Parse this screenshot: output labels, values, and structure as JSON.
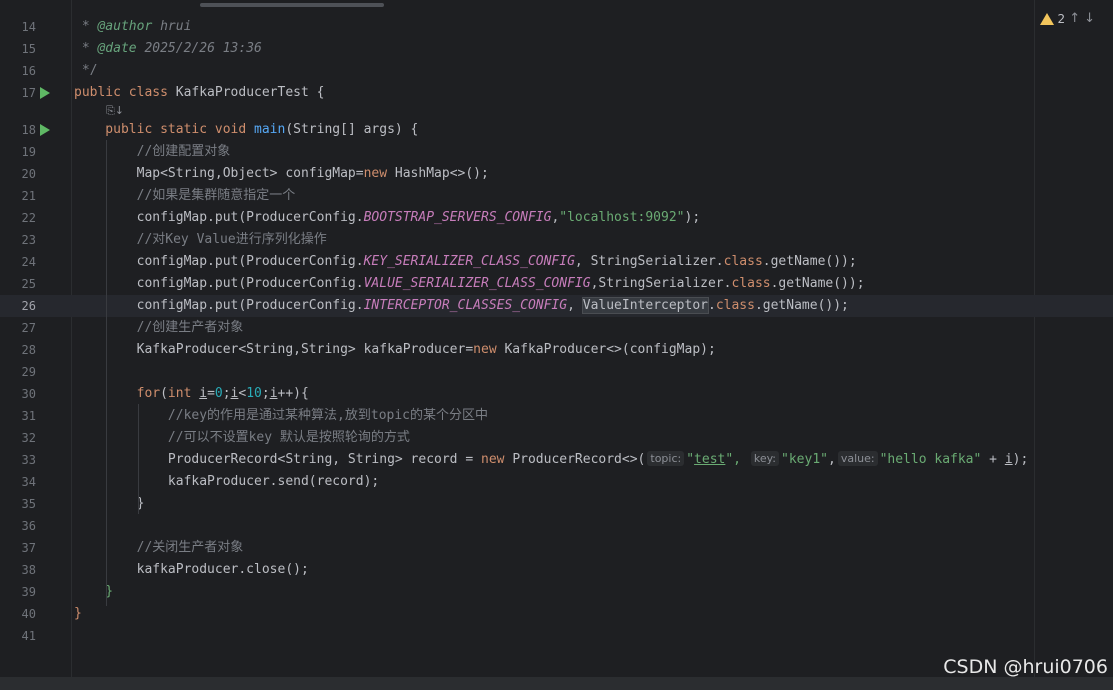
{
  "editor": {
    "warnings": {
      "count": "2"
    },
    "inline_hint": "⎘↓",
    "lines": [
      {
        "n": "14",
        "tokens": [
          {
            "t": " * ",
            "c": "cmt"
          },
          {
            "t": "@author",
            "c": "doctag"
          },
          {
            "t": " hrui",
            "c": "docval"
          }
        ]
      },
      {
        "n": "15",
        "tokens": [
          {
            "t": " * ",
            "c": "cmt"
          },
          {
            "t": "@date",
            "c": "doctag"
          },
          {
            "t": " 2025/2/26 13:36",
            "c": "docval"
          }
        ]
      },
      {
        "n": "16",
        "tokens": [
          {
            "t": " */",
            "c": "cmt"
          }
        ]
      },
      {
        "n": "17",
        "run": true,
        "tokens": [
          {
            "t": "public class ",
            "c": "kw"
          },
          {
            "t": "KafkaProducerTest ",
            "c": "cls"
          },
          {
            "t": "{",
            "c": "dim"
          }
        ]
      },
      {
        "n": "18",
        "run": true,
        "tokens": [
          {
            "t": "    public static void ",
            "c": "kw"
          },
          {
            "t": "main",
            "c": "fn"
          },
          {
            "t": "(String[] args) {",
            "c": "dim"
          }
        ]
      },
      {
        "n": "19",
        "tokens": [
          {
            "t": "        //创建配置对象",
            "c": "cmt"
          }
        ]
      },
      {
        "n": "20",
        "tokens": [
          {
            "t": "        Map<String,Object> configMap=",
            "c": "dim"
          },
          {
            "t": "new ",
            "c": "kw"
          },
          {
            "t": "HashMap<>();",
            "c": "dim"
          }
        ]
      },
      {
        "n": "21",
        "tokens": [
          {
            "t": "        //如果是集群随意指定一个",
            "c": "cmt"
          }
        ]
      },
      {
        "n": "22",
        "tokens": [
          {
            "t": "        configMap.put(ProducerConfig.",
            "c": "dim"
          },
          {
            "t": "BOOTSTRAP_SERVERS_CONFIG",
            "c": "konst"
          },
          {
            "t": ",",
            "c": "dim"
          },
          {
            "t": "\"localhost:9092\"",
            "c": "str"
          },
          {
            "t": ");",
            "c": "dim"
          }
        ]
      },
      {
        "n": "23",
        "tokens": [
          {
            "t": "        //对Key Value进行序列化操作",
            "c": "cmt"
          }
        ]
      },
      {
        "n": "24",
        "tokens": [
          {
            "t": "        configMap.put(ProducerConfig.",
            "c": "dim"
          },
          {
            "t": "KEY_SERIALIZER_CLASS_CONFIG",
            "c": "konst"
          },
          {
            "t": ", StringSerializer.",
            "c": "dim"
          },
          {
            "t": "class",
            "c": "kw"
          },
          {
            "t": ".getName());",
            "c": "dim"
          }
        ]
      },
      {
        "n": "25",
        "tokens": [
          {
            "t": "        configMap.put(ProducerConfig.",
            "c": "dim"
          },
          {
            "t": "VALUE_SERIALIZER_CLASS_CONFIG",
            "c": "konst"
          },
          {
            "t": ",StringSerializer.",
            "c": "dim"
          },
          {
            "t": "class",
            "c": "kw"
          },
          {
            "t": ".getName());",
            "c": "dim"
          }
        ]
      },
      {
        "n": "26",
        "current": true,
        "tokens": [
          {
            "t": "        configMap.put(ProducerConfig.",
            "c": "dim"
          },
          {
            "t": "INTERCEPTOR_CLASSES_CONFIG",
            "c": "konst"
          },
          {
            "t": ", ",
            "c": "dim"
          },
          {
            "t": "ValueInterceptor",
            "c": "dim highlight-word"
          },
          {
            "t": ".",
            "c": "dim"
          },
          {
            "t": "class",
            "c": "kw"
          },
          {
            "t": ".getName());",
            "c": "dim"
          }
        ]
      },
      {
        "n": "27",
        "tokens": [
          {
            "t": "        //创建生产者对象",
            "c": "cmt"
          }
        ]
      },
      {
        "n": "28",
        "tokens": [
          {
            "t": "        KafkaProducer<String,String> kafkaProducer=",
            "c": "dim"
          },
          {
            "t": "new ",
            "c": "kw"
          },
          {
            "t": "KafkaProducer<>(configMap);",
            "c": "dim"
          }
        ]
      },
      {
        "n": "29",
        "tokens": []
      },
      {
        "n": "30",
        "tokens": [
          {
            "t": "        for",
            "c": "kw"
          },
          {
            "t": "(",
            "c": "dim"
          },
          {
            "t": "int ",
            "c": "kw"
          },
          {
            "t": "i",
            "c": "dim underline"
          },
          {
            "t": "=",
            "c": "dim"
          },
          {
            "t": "0",
            "c": "num"
          },
          {
            "t": ";",
            "c": "dim"
          },
          {
            "t": "i",
            "c": "dim underline"
          },
          {
            "t": "<",
            "c": "dim"
          },
          {
            "t": "10",
            "c": "num"
          },
          {
            "t": ";",
            "c": "dim"
          },
          {
            "t": "i",
            "c": "dim underline"
          },
          {
            "t": "++){",
            "c": "dim"
          }
        ]
      },
      {
        "n": "31",
        "tokens": [
          {
            "t": "            //key的作用是通过某种算法,放到topic的某个分区中",
            "c": "cmt"
          }
        ]
      },
      {
        "n": "32",
        "tokens": [
          {
            "t": "            //可以不设置key 默认是按照轮询的方式",
            "c": "cmt"
          }
        ]
      },
      {
        "n": "33",
        "tokens": [
          {
            "t": "            ProducerRecord<String, String> record = ",
            "c": "dim"
          },
          {
            "t": "new ",
            "c": "kw"
          },
          {
            "t": "ProducerRecord<>(",
            "c": "dim"
          },
          {
            "t": "topic:",
            "c": "param"
          },
          {
            "t": "\"",
            "c": "str"
          },
          {
            "t": "test",
            "c": "str underline"
          },
          {
            "t": "\", ",
            "c": "str"
          },
          {
            "t": "key:",
            "c": "param"
          },
          {
            "t": "\"key1\"",
            "c": "str"
          },
          {
            "t": ",",
            "c": "dim"
          },
          {
            "t": "value:",
            "c": "param"
          },
          {
            "t": "\"hello kafka\"",
            "c": "str"
          },
          {
            "t": " + ",
            "c": "dim"
          },
          {
            "t": "i",
            "c": "dim underline"
          },
          {
            "t": ");",
            "c": "dim"
          }
        ]
      },
      {
        "n": "34",
        "tokens": [
          {
            "t": "            kafkaProducer.send(record);",
            "c": "dim"
          }
        ]
      },
      {
        "n": "35",
        "tokens": [
          {
            "t": "        }",
            "c": "dim"
          }
        ]
      },
      {
        "n": "36",
        "tokens": []
      },
      {
        "n": "37",
        "tokens": [
          {
            "t": "        //关闭生产者对象",
            "c": "cmt"
          }
        ]
      },
      {
        "n": "38",
        "tokens": [
          {
            "t": "        kafkaProducer.close();",
            "c": "dim"
          }
        ]
      },
      {
        "n": "39",
        "tokens": [
          {
            "t": "    }",
            "c": "str"
          }
        ]
      },
      {
        "n": "40",
        "tokens": [
          {
            "t": "}",
            "c": "kw"
          }
        ]
      },
      {
        "n": "41",
        "tokens": []
      }
    ]
  },
  "watermark": "CSDN @hrui0706",
  "colors": {
    "background": "#1e1f22",
    "keyword": "#cf8e6d",
    "comment": "#7a7e85",
    "string": "#6aab73",
    "number": "#2aacb8",
    "constant": "#c77dbb",
    "method": "#56a8f5",
    "warning": "#f2c55c",
    "run": "#5fb865"
  },
  "icons": {
    "run": "run-gutter-icon",
    "warning": "warning-icon"
  }
}
